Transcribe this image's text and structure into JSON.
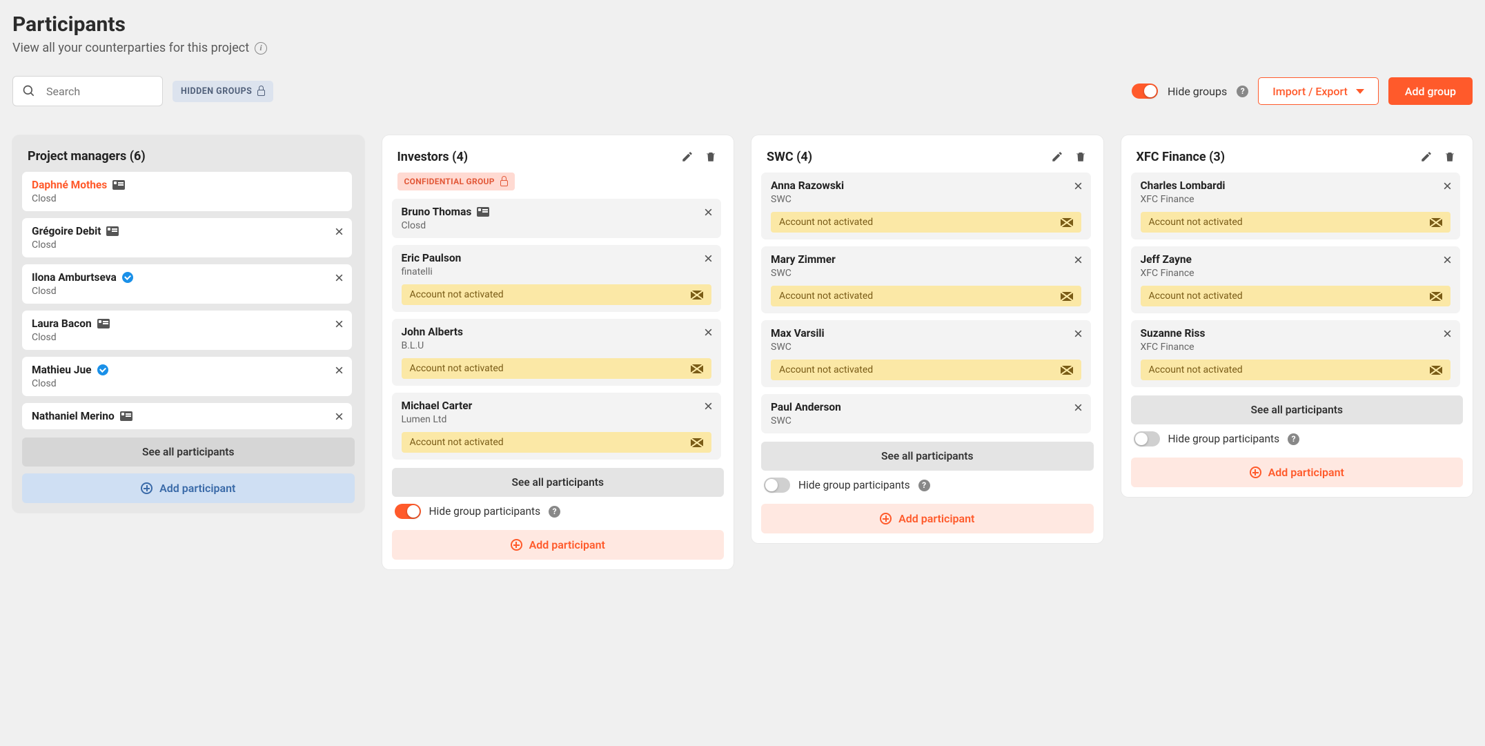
{
  "header": {
    "title": "Participants",
    "subtitle": "View all your counterparties for this project"
  },
  "toolbar": {
    "search_placeholder": "Search",
    "hidden_groups_label": "HIDDEN GROUPS",
    "hide_groups_label": "Hide groups",
    "import_export_label": "Import / Export",
    "add_group_label": "Add group"
  },
  "common": {
    "see_all": "See all participants",
    "add_participant": "Add participant",
    "hide_group_participants": "Hide group participants",
    "account_not_activated": "Account not activated",
    "confidential_group": "CONFIDENTIAL GROUP"
  },
  "groups": [
    {
      "id": "pm",
      "title": "Project managers (6)",
      "admin": true,
      "confidential": false,
      "editable": false,
      "hide_toggle": null,
      "members": [
        {
          "name": "Daphné Mothes",
          "org": "Closd",
          "highlight": true,
          "card_badge": true,
          "verified": false,
          "removable": false,
          "not_activated": false
        },
        {
          "name": "Grégoire Debit",
          "org": "Closd",
          "highlight": false,
          "card_badge": true,
          "verified": false,
          "removable": true,
          "not_activated": false
        },
        {
          "name": "Ilona Amburtseva",
          "org": "Closd",
          "highlight": false,
          "card_badge": false,
          "verified": true,
          "removable": true,
          "not_activated": false
        },
        {
          "name": "Laura Bacon",
          "org": "Closd",
          "highlight": false,
          "card_badge": true,
          "verified": false,
          "removable": true,
          "not_activated": false
        },
        {
          "name": "Mathieu Jue",
          "org": "Closd",
          "highlight": false,
          "card_badge": false,
          "verified": true,
          "removable": true,
          "not_activated": false
        },
        {
          "name": "Nathaniel Merino",
          "org": "",
          "highlight": false,
          "card_badge": true,
          "verified": false,
          "removable": true,
          "not_activated": false
        }
      ]
    },
    {
      "id": "investors",
      "title": "Investors (4)",
      "admin": false,
      "confidential": true,
      "editable": true,
      "hide_toggle": true,
      "members": [
        {
          "name": "Bruno Thomas",
          "org": "Closd",
          "highlight": false,
          "card_badge": true,
          "verified": false,
          "removable": true,
          "not_activated": false
        },
        {
          "name": "Eric Paulson",
          "org": "finatelli",
          "highlight": false,
          "card_badge": false,
          "verified": false,
          "removable": true,
          "not_activated": true
        },
        {
          "name": "John Alberts",
          "org": "B.L.U",
          "highlight": false,
          "card_badge": false,
          "verified": false,
          "removable": true,
          "not_activated": true
        },
        {
          "name": "Michael Carter",
          "org": "Lumen Ltd",
          "highlight": false,
          "card_badge": false,
          "verified": false,
          "removable": true,
          "not_activated": true
        }
      ]
    },
    {
      "id": "swc",
      "title": "SWC (4)",
      "admin": false,
      "confidential": false,
      "editable": true,
      "hide_toggle": false,
      "members": [
        {
          "name": "Anna Razowski",
          "org": "SWC",
          "highlight": false,
          "card_badge": false,
          "verified": false,
          "removable": true,
          "not_activated": true
        },
        {
          "name": "Mary Zimmer",
          "org": "SWC",
          "highlight": false,
          "card_badge": false,
          "verified": false,
          "removable": true,
          "not_activated": true
        },
        {
          "name": "Max Varsili",
          "org": "SWC",
          "highlight": false,
          "card_badge": false,
          "verified": false,
          "removable": true,
          "not_activated": true
        },
        {
          "name": "Paul Anderson",
          "org": "SWC",
          "highlight": false,
          "card_badge": false,
          "verified": false,
          "removable": true,
          "not_activated": false
        }
      ]
    },
    {
      "id": "xfc",
      "title": "XFC Finance (3)",
      "admin": false,
      "confidential": false,
      "editable": true,
      "hide_toggle": false,
      "members": [
        {
          "name": "Charles Lombardi",
          "org": "XFC Finance",
          "highlight": false,
          "card_badge": false,
          "verified": false,
          "removable": true,
          "not_activated": true
        },
        {
          "name": "Jeff Zayne",
          "org": "XFC Finance",
          "highlight": false,
          "card_badge": false,
          "verified": false,
          "removable": true,
          "not_activated": true
        },
        {
          "name": "Suzanne Riss",
          "org": "XFC Finance",
          "highlight": false,
          "card_badge": false,
          "verified": false,
          "removable": true,
          "not_activated": true
        }
      ]
    }
  ]
}
